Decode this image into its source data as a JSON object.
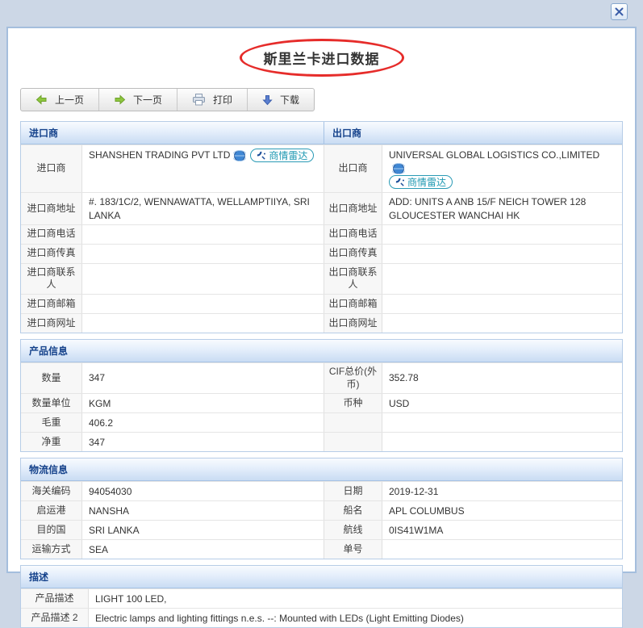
{
  "dialog": {
    "title": "斯里兰卡进口数据"
  },
  "toolbar": {
    "prev": "上一页",
    "next": "下一页",
    "print": "打印",
    "download": "下载"
  },
  "sections": {
    "importer_header": "进口商",
    "exporter_header": "出口商",
    "product_header": "产品信息",
    "logistics_header": "物流信息",
    "description_header": "描述"
  },
  "radar_badge": "商情雷达",
  "party_rows": [
    {
      "l1": "进口商",
      "v1": "SHANSHEN TRADING PVT LTD",
      "l2": "出口商",
      "v2": "UNIVERSAL GLOBAL LOGISTICS CO.,LIMITED"
    },
    {
      "l1": "进口商地址",
      "v1": "#. 183/1C/2, WENNAWATTA, WELLAMPTIIYA, SRI LANKA",
      "l2": "出口商地址",
      "v2": "ADD: UNITS A ANB 15/F NEICH TOWER 128 GLOUCESTER WANCHAI HK"
    },
    {
      "l1": "进口商电话",
      "v1": "",
      "l2": "出口商电话",
      "v2": ""
    },
    {
      "l1": "进口商传真",
      "v1": "",
      "l2": "出口商传真",
      "v2": ""
    },
    {
      "l1": "进口商联系人",
      "v1": "",
      "l2": "出口商联系人",
      "v2": ""
    },
    {
      "l1": "进口商邮箱",
      "v1": "",
      "l2": "出口商邮箱",
      "v2": ""
    },
    {
      "l1": "进口商网址",
      "v1": "",
      "l2": "出口商网址",
      "v2": ""
    }
  ],
  "product_rows": [
    {
      "l1": "数量",
      "v1": "347",
      "l2": "CIF总价(外币)",
      "v2": "352.78"
    },
    {
      "l1": "数量单位",
      "v1": "KGM",
      "l2": "币种",
      "v2": "USD"
    },
    {
      "l1": "毛重",
      "v1": "406.2",
      "l2": "",
      "v2": ""
    },
    {
      "l1": "净重",
      "v1": "347",
      "l2": "",
      "v2": ""
    }
  ],
  "logistics_rows": [
    {
      "l1": "海关编码",
      "v1": "94054030",
      "l2": "日期",
      "v2": "2019-12-31"
    },
    {
      "l1": "启运港",
      "v1": "NANSHA",
      "l2": "船名",
      "v2": "APL COLUMBUS"
    },
    {
      "l1": "目的国",
      "v1": "SRI LANKA",
      "l2": "航线",
      "v2": "0IS41W1MA"
    },
    {
      "l1": "运输方式",
      "v1": "SEA",
      "l2": "单号",
      "v2": ""
    }
  ],
  "description_rows": [
    {
      "label": "产品描述",
      "value": "LIGHT 100 LED,"
    },
    {
      "label": "产品描述 2",
      "value": "Electric lamps and lighting fittings n.e.s. --: Mounted with LEDs (Light Emitting Diodes)"
    }
  ],
  "icons": {
    "close": "x-cross",
    "prev": "green-arrow-left",
    "next": "green-arrow-right",
    "print": "printer",
    "download": "blue-arrow-down",
    "company": "globe",
    "radar": "satellite-dish"
  },
  "colors": {
    "page_background": "#ccd7e6",
    "panel_border": "#a4bedd",
    "section_header_text": "#15428b",
    "annotation_red": "#e62c2a",
    "radar_teal": "#1e98b2"
  }
}
